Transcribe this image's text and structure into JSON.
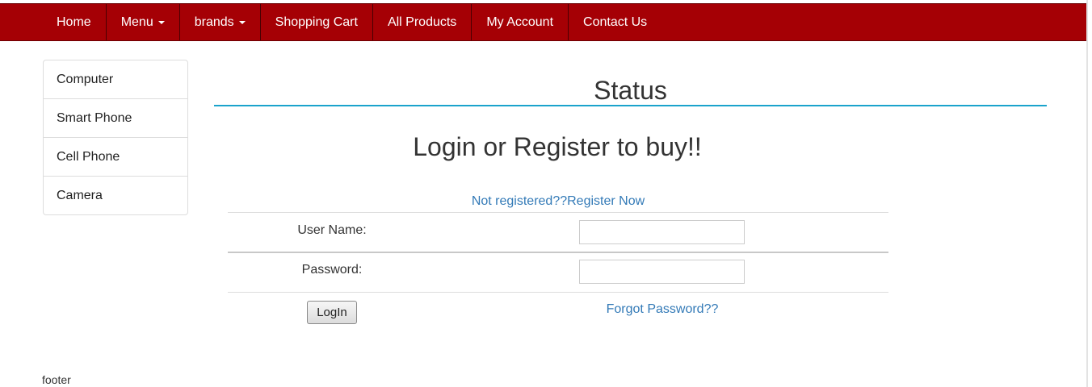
{
  "nav": {
    "items": [
      {
        "label": "Home",
        "dropdown": false
      },
      {
        "label": "Menu",
        "dropdown": true
      },
      {
        "label": "brands",
        "dropdown": true
      },
      {
        "label": "Shopping Cart",
        "dropdown": false
      },
      {
        "label": "All Products",
        "dropdown": false
      },
      {
        "label": "My Account",
        "dropdown": false
      },
      {
        "label": "Contact Us",
        "dropdown": false
      }
    ]
  },
  "sidebar": {
    "items": [
      {
        "label": "Computer"
      },
      {
        "label": "Smart Phone"
      },
      {
        "label": "Cell Phone"
      },
      {
        "label": "Camera"
      }
    ]
  },
  "main": {
    "status_title": "Status",
    "login_heading": "Login or Register to buy!!",
    "register_link": "Not registered??Register Now",
    "username_label": "User Name:",
    "username_value": "",
    "password_label": "Password:",
    "password_value": "",
    "login_button": "LogIn",
    "forgot_link": "Forgot Password??"
  },
  "footer": {
    "text": "footer"
  },
  "colors": {
    "navbar_bg": "#a50005",
    "accent_rule": "#1aa3cc",
    "link": "#337ab7"
  }
}
